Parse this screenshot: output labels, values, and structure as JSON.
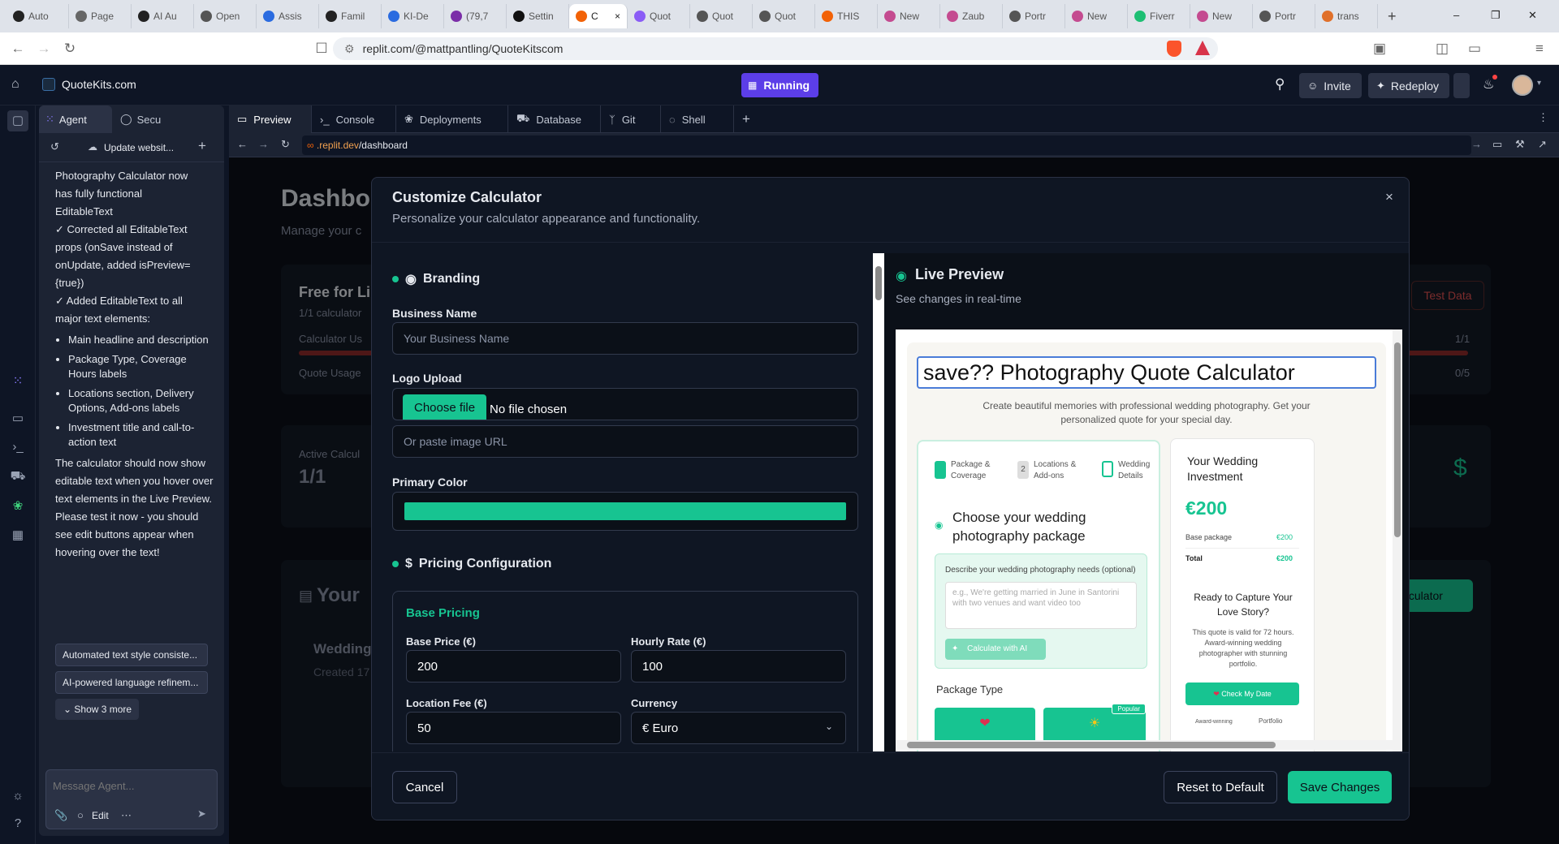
{
  "browser": {
    "tabs": [
      {
        "label": "Auto",
        "color": "#222"
      },
      {
        "label": "Page",
        "color": "#666"
      },
      {
        "label": "AI Au",
        "color": "#222"
      },
      {
        "label": "Open",
        "color": "#555"
      },
      {
        "label": "Assis",
        "color": "#2a6be0"
      },
      {
        "label": "Famil",
        "color": "#222"
      },
      {
        "label": "KI-De",
        "color": "#2a6be0"
      },
      {
        "label": "(79,7",
        "color": "#7b2ea8"
      },
      {
        "label": "Settin",
        "color": "#111"
      },
      {
        "label": "C",
        "color": "#f26207"
      },
      {
        "label": "Quot",
        "color": "#8a5cf6"
      },
      {
        "label": "Quot",
        "color": "#555"
      },
      {
        "label": "Quot",
        "color": "#555"
      },
      {
        "label": "THIS",
        "color": "#f26207"
      },
      {
        "label": "New",
        "color": "#c44b90"
      },
      {
        "label": "Zaub",
        "color": "#c44b90"
      },
      {
        "label": "Portr",
        "color": "#555"
      },
      {
        "label": "New",
        "color": "#c44b90"
      },
      {
        "label": "Fiverr",
        "color": "#1dbf73"
      },
      {
        "label": "New",
        "color": "#c44b90"
      },
      {
        "label": "Portr",
        "color": "#555"
      },
      {
        "label": "trans",
        "color": "#e0702a"
      }
    ],
    "url": "replit.com/@mattpantling/QuoteKitscom"
  },
  "replit": {
    "project": "QuoteKits.com",
    "run_label": "Running",
    "invite": "Invite",
    "redeploy": "Redeploy"
  },
  "agent": {
    "tab_agent": "Agent",
    "tab_secu": "Secu",
    "thread_title": "Update websit...",
    "intro_lines": [
      "Photography Calculator now",
      "has fully functional",
      "EditableText",
      "✓ Corrected all EditableText",
      "props (onSave instead of",
      "onUpdate, added isPreview=",
      "{true})",
      "✓ Added EditableText to all",
      "major text elements:"
    ],
    "bullets": [
      "Main headline and description",
      "Package Type, Coverage Hours labels",
      "Locations section, Delivery Options, Add-ons labels",
      "Investment title and call-to-action text"
    ],
    "closing": "The calculator should now show editable text when you hover over text elements in the Live Preview. Please test it now - you should see edit buttons appear when hovering over the text!",
    "suggestions": [
      "Automated text style consiste...",
      "AI-powered language refinem..."
    ],
    "show_more": "Show 3 more",
    "message_placeholder": "Message Agent...",
    "edit_label": "Edit"
  },
  "workspace": {
    "tabs": [
      "Preview",
      "Console",
      "Deployments",
      "Database",
      "Git",
      "Shell"
    ],
    "url_prefix": ".replit.dev",
    "url_path": "/dashboard"
  },
  "dashboard": {
    "title": "Dashbo",
    "subtitle": "Manage your c",
    "plan_title": "Free for Li",
    "plan_sub": "1/1 calculator",
    "calc_usage": "Calculator Us",
    "calc_usage_val": "1/1",
    "quote_usage": "Quote Usage",
    "quote_usage_val": "0/5",
    "test_data": "Test Data",
    "active_label": "Active Calcul",
    "active_val": "1/1",
    "your": "Your",
    "calculator_btn": "alculator",
    "wedding": "Wedding",
    "created": "Created 17"
  },
  "modal": {
    "title": "Customize Calculator",
    "subtitle": "Personalize your calculator appearance and functionality.",
    "branding": "Branding",
    "business_name_label": "Business Name",
    "business_name_placeholder": "Your Business Name",
    "logo_upload_label": "Logo Upload",
    "choose_file": "Choose file",
    "no_file": "No file chosen",
    "image_url_placeholder": "Or paste image URL",
    "primary_color_label": "Primary Color",
    "primary_color": "#17c491",
    "pricing_config": "Pricing Configuration",
    "base_pricing": "Base Pricing",
    "base_price_label": "Base Price (€)",
    "base_price": "200",
    "hourly_rate_label": "Hourly Rate (€)",
    "hourly_rate": "100",
    "location_fee_label": "Location Fee (€)",
    "location_fee": "50",
    "currency_label": "Currency",
    "currency": "€ Euro",
    "cancel": "Cancel",
    "reset": "Reset to Default",
    "save": "Save Changes"
  },
  "preview": {
    "title": "Live Preview",
    "subtitle": "See changes in real-time",
    "headline": "save?? Photography Quote Calculator",
    "description": "Create beautiful memories with professional wedding photography. Get your personalized quote for your special day.",
    "steps": [
      {
        "num": "1",
        "label": "Package & Coverage"
      },
      {
        "num": "2",
        "label": "Locations & Add-ons"
      },
      {
        "num": "3",
        "label": "Wedding Details"
      }
    ],
    "choose_package": "Choose your wedding photography package",
    "ai_prompt_label": "Describe your wedding photography needs (optional)",
    "ai_placeholder": "e.g., We're getting married in June in Santorini with two venues and want video too",
    "ai_button": "Calculate with AI",
    "package_type": "Package Type",
    "popular": "Popular",
    "investment_title": "Your Wedding Investment",
    "investment_total": "€200",
    "base_package_label": "Base package",
    "base_package_val": "€200",
    "total_label": "Total",
    "total_val": "€200",
    "cta_title": "Ready to Capture Your Love Story?",
    "cta_text": "This quote is valid for 72 hours. Award-winning wedding photographer with stunning portfolio.",
    "check_date": "Check My Date",
    "award": "Award-winning",
    "portfolio": "Portfolio"
  }
}
